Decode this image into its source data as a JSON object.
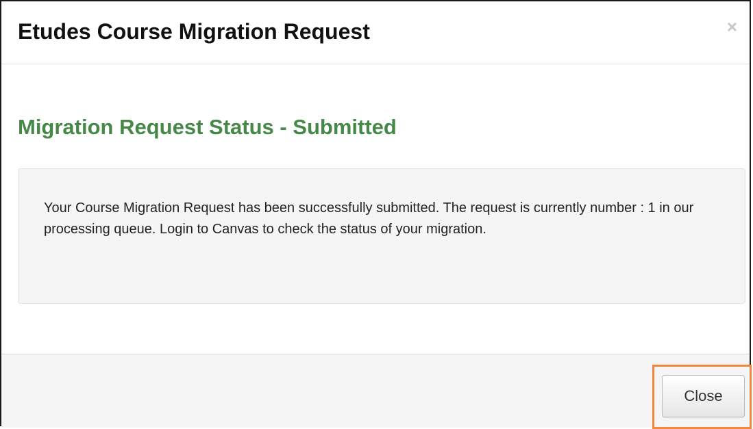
{
  "dialog": {
    "title": "Etudes Course Migration Request",
    "close_icon_glyph": "×"
  },
  "body": {
    "status_heading": "Migration Request Status - Submitted",
    "message": "Your Course Migration Request has been successfully submitted. The request is currently number : 1 in our processing queue. Login to Canvas to check the status of your migration."
  },
  "footer": {
    "close_label": "Close"
  },
  "colors": {
    "heading_green": "#468847",
    "highlight_orange": "#f0883e",
    "well_background": "#f5f5f5"
  }
}
